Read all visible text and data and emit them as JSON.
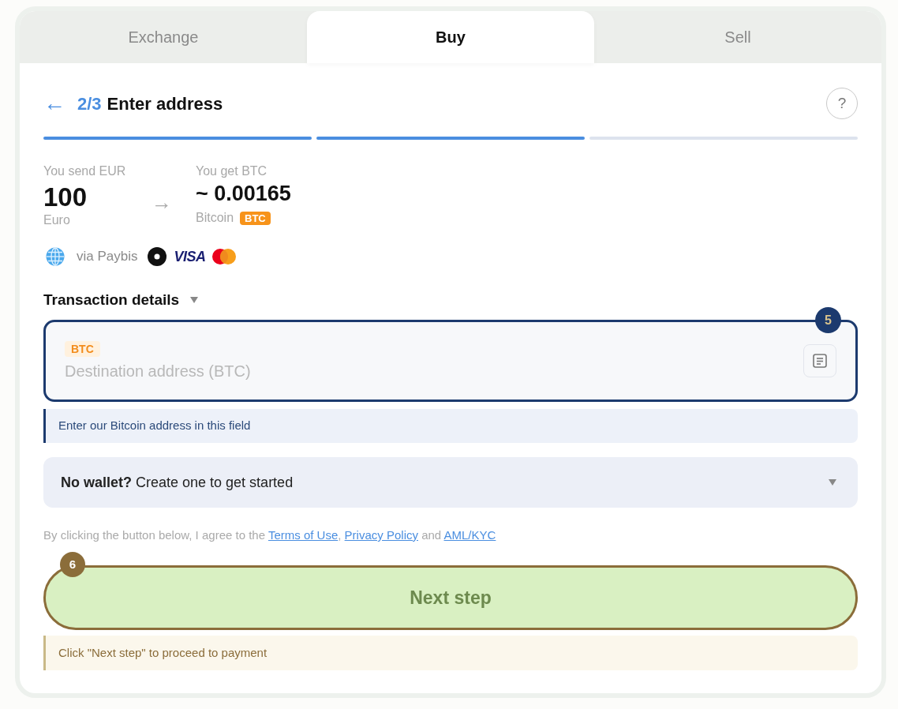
{
  "tabs": [
    {
      "label": "Exchange",
      "selected": false
    },
    {
      "label": "Buy",
      "selected": true
    },
    {
      "label": "Sell",
      "selected": false
    }
  ],
  "header": {
    "back": "←",
    "step": "2/3",
    "title": "Enter address",
    "help": "?"
  },
  "progress": [
    {
      "completed": true
    },
    {
      "completed": true
    },
    {
      "completed": false
    }
  ],
  "send": {
    "label": "You send EUR",
    "amount": "100",
    "currency": "Euro"
  },
  "arrow": "→",
  "receive": {
    "label": "You get BTC",
    "amount": "~ 0.00165",
    "currency": "Bitcoin",
    "badge": "BTC"
  },
  "payment": {
    "provider": "via Paybis",
    "methods": [
      {
        "kind": "dot"
      },
      {
        "kind": "visa",
        "label": "VISA"
      },
      {
        "kind": "mastercard"
      }
    ]
  },
  "transaction_details": {
    "title": "Transaction details"
  },
  "address_field": {
    "tag": "BTC",
    "placeholder": "Destination address (BTC)",
    "step_badge": "5"
  },
  "address_hint": "Enter our Bitcoin address in this field",
  "wallet_prompt": "**No wallet?** Create one to get started",
  "terms": [
    {
      "kind": "text",
      "text": "By clicking the button below, I agree to the "
    },
    {
      "kind": "link",
      "text": "Terms of Use"
    },
    {
      "kind": "text",
      "text": ", "
    },
    {
      "kind": "link",
      "text": "Privacy Policy"
    },
    {
      "kind": "text",
      "text": " and "
    },
    {
      "kind": "link",
      "text": "AML/KYC"
    }
  ],
  "next_button": {
    "label": "Next step",
    "step_badge": "6"
  },
  "next_hint": "Click \"Next step\" to proceed to payment"
}
